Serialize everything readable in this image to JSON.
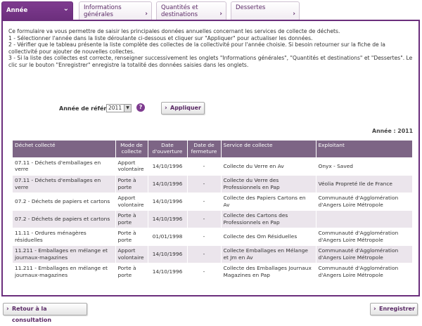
{
  "tabs": [
    {
      "label": "Année"
    },
    {
      "label": "Informations générales"
    },
    {
      "label": "Quantités et destinations"
    },
    {
      "label": "Dessertes"
    }
  ],
  "intro": [
    "Ce formulaire va vous permettre de saisir les principales données annuelles concernant les services de collecte de déchets.",
    "1 - Sélectionner l'année dans la liste déroulante ci-dessous et cliquer sur \"Appliquer\" pour actualiser les données.",
    "2 - Vérifier que le tableau présente la liste complète des collectes de la collectivité pour l'année choisie. Si besoin retourner sur la fiche de la collectivité pour ajouter de nouvelles collectes.",
    "3 - Si la liste des collectes est correcte, renseigner successivement les onglets \"Informations générales\", \"Quantités et destinations\" et \"Dessertes\". Le clic sur le bouton \"Enregistrer\" enregistre la totalité des données saisies dans les onglets."
  ],
  "reference": {
    "label": "Année de référence :",
    "selected_year": "2011",
    "apply_label": "Appliquer"
  },
  "year_summary": "Année : 2011",
  "table": {
    "headers": [
      "Déchet collecté",
      "Mode de collecte",
      "Date d'ouverture",
      "Date de fermeture",
      "Service de collecte",
      "Exploitant"
    ],
    "rows": [
      [
        "07.11 - Déchets d'emballages en verre",
        "Apport volontaire",
        "14/10/1996",
        "-",
        "Collecte du Verre en Av",
        "Onyx - Saved"
      ],
      [
        "07.11 - Déchets d'emballages en verre",
        "Porte à porte",
        "14/10/1996",
        "-",
        "Collecte du Verre des Professionnels en Pap",
        "Véolia Propreté Ile de France"
      ],
      [
        "07.2 - Déchets de papiers et cartons",
        "Apport volontaire",
        "14/10/1996",
        "-",
        "Collecte des Papiers Cartons en Av",
        "Communauté d'Agglomération d'Angers Loire Métropole"
      ],
      [
        "07.2 - Déchets de papiers et cartons",
        "Porte à porte",
        "14/10/1996",
        "-",
        "Collecte des Cartons des Professionnels en Pap",
        ""
      ],
      [
        "11.11 - Ordures ménagères résiduelles",
        "Porte à porte",
        "01/01/1998",
        "-",
        "Collecte des Om Résiduelles",
        "Communauté d'Agglomération d'Angers Loire Métropole"
      ],
      [
        "11.211 - Emballages en mélange et journaux-magazines",
        "Apport volontaire",
        "14/10/1996",
        "-",
        "Collecte Emballages en Mélange et Jm en Av",
        "Communauté d'Agglomération d'Angers Loire Métropole"
      ],
      [
        "11.211 - Emballages en mélange et journaux-magazines",
        "Porte à porte",
        "14/10/1996",
        "-",
        "Collecte des Emballages Journaux Magazines en Pap",
        "Communauté d'Agglomération d'Angers Loire Métropole"
      ]
    ]
  },
  "footer": {
    "back_label": "Retour à la consultation",
    "save_label": "Enregistrer"
  },
  "colors": {
    "accent": "#6b2e7c",
    "table_header": "#7d6585",
    "row_alt": "#ebe5ec"
  }
}
